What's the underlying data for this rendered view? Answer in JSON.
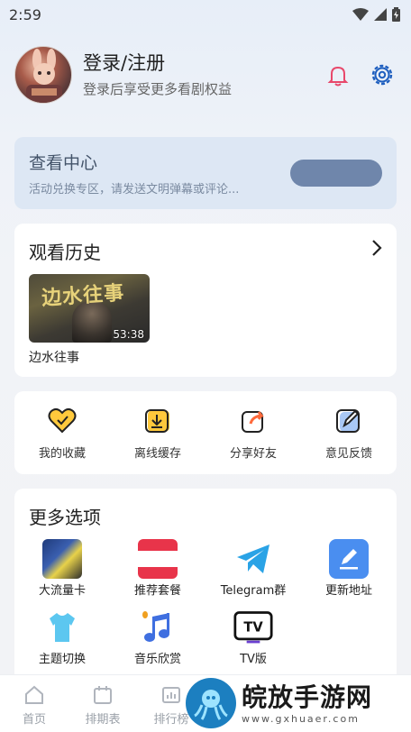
{
  "status_bar": {
    "time": "2:59"
  },
  "profile": {
    "name": "登录/注册",
    "subtitle": "登录后享受更多看剧权益"
  },
  "center_card": {
    "title": "查看中心",
    "subtitle": "活动兑换专区，请发送文明弹幕或评论...",
    "button_color": "#6f86ab"
  },
  "history": {
    "title": "观看历史",
    "items": [
      {
        "name": "边水往事",
        "thumb_title": "边水往事",
        "duration": "53:38"
      }
    ]
  },
  "quick_actions": [
    {
      "label": "我的收藏",
      "icon": "heart-icon"
    },
    {
      "label": "离线缓存",
      "icon": "download-icon"
    },
    {
      "label": "分享好友",
      "icon": "share-icon"
    },
    {
      "label": "意见反馈",
      "icon": "feedback-icon"
    }
  ],
  "more_options": {
    "title": "更多选项",
    "items": [
      {
        "label": "大流量卡",
        "icon": "sim-card-promo-icon"
      },
      {
        "label": "推荐套餐",
        "icon": "plan-promo-icon"
      },
      {
        "label": "Telegram群",
        "icon": "telegram-icon"
      },
      {
        "label": "更新地址",
        "icon": "edit-icon"
      },
      {
        "label": "主题切换",
        "icon": "tshirt-icon"
      },
      {
        "label": "音乐欣赏",
        "icon": "music-icon"
      },
      {
        "label": "TV版",
        "icon": "tv-icon"
      }
    ]
  },
  "tabbar": [
    {
      "label": "首页",
      "icon": "home-icon"
    },
    {
      "label": "排期表",
      "icon": "calendar-icon"
    },
    {
      "label": "排行榜",
      "icon": "chart-icon"
    }
  ],
  "watermark": {
    "main": "皖放手游网",
    "url": "www.gxhuaer.com"
  },
  "colors": {
    "accent": "#1f5fbf",
    "bell": "#e8486b",
    "card_blue": "#dde7f4"
  }
}
